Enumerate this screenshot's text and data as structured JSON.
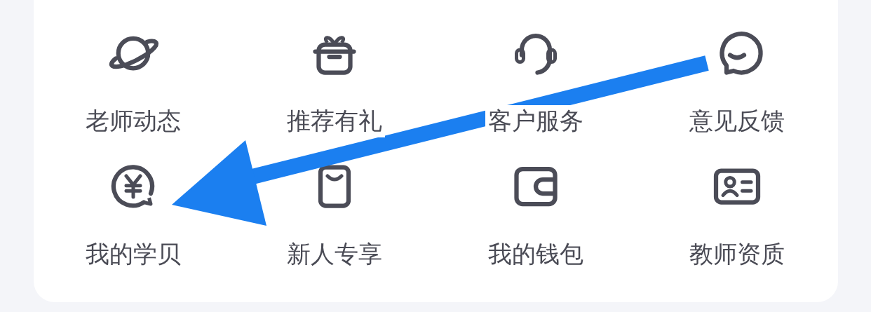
{
  "menu_items": [
    {
      "label": "老师动态"
    },
    {
      "label": "推荐有礼"
    },
    {
      "label": "客户服务"
    },
    {
      "label": "意见反馈"
    },
    {
      "label": "我的学贝"
    },
    {
      "label": "新人专享"
    },
    {
      "label": "我的钱包"
    },
    {
      "label": "教师资质"
    }
  ]
}
